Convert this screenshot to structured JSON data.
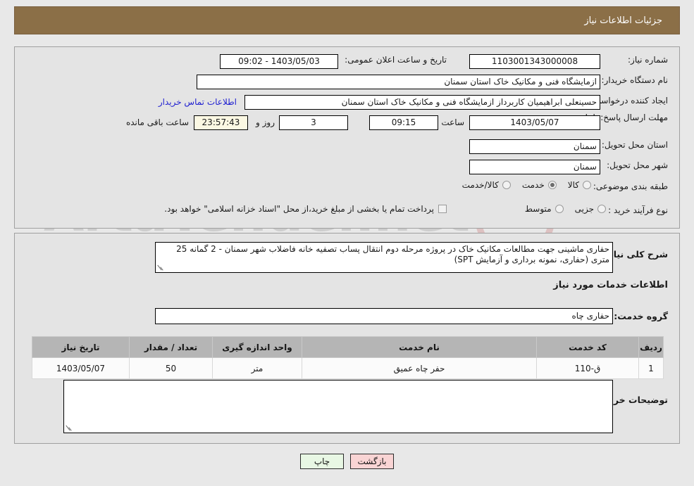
{
  "header": {
    "title": "جزئیات اطلاعات نیاز"
  },
  "watermark": {
    "text": "ArtaTender.net"
  },
  "top_panel": {
    "need_number": {
      "label": "شماره نیاز:",
      "value": "1103001343000008"
    },
    "announce_datetime": {
      "label": "تاریخ و ساعت اعلان عمومی:",
      "value": "1403/05/03 - 09:02"
    },
    "buyer_org": {
      "label": "نام دستگاه خریدار:",
      "value": "ازمایشگاه فنی و مکانیک خاک استان سمنان"
    },
    "requester": {
      "label": "ایجاد کننده درخواست:",
      "value": "حسینعلی ابراهیمیان کاربرداز ازمایشگاه فنی و مکانیک خاک استان سمنان",
      "contact_link": "اطلاعات تماس خریدار"
    },
    "deadline": {
      "label": "مهلت ارسال پاسخ: تا تاریخ:",
      "date": "1403/05/07",
      "time_label": "ساعت",
      "time": "09:15",
      "days": "3",
      "days_label": "روز و",
      "countdown": "23:57:43",
      "countdown_label": "ساعت باقی مانده"
    },
    "province": {
      "label": "استان محل تحویل:",
      "value": "سمنان"
    },
    "city": {
      "label": "شهر محل تحویل:",
      "value": "سمنان"
    },
    "category": {
      "label": "طبقه بندی موضوعی:",
      "options": [
        {
          "label": "کالا",
          "selected": false
        },
        {
          "label": "خدمت",
          "selected": true
        },
        {
          "label": "کالا/خدمت",
          "selected": false
        }
      ]
    },
    "purchase_type": {
      "label": "نوع فرآیند خرید :",
      "options": [
        {
          "label": "جزیی",
          "selected": false
        },
        {
          "label": "متوسط",
          "selected": false
        }
      ],
      "checkbox_label": "پرداخت تمام یا بخشی از مبلغ خرید،از محل \"اسناد خزانه اسلامی\" خواهد بود.",
      "checkbox_checked": false
    }
  },
  "mid_panel": {
    "general_desc": {
      "label": "شرح کلی نیاز:",
      "value": "حفاری ماشینی جهت مطالعات مکانیک خاک در پروژه مرحله دوم انتقال پساب تصفیه خانه فاضلاب شهر سمنان - 2 گمانه 25 متری (حفاری، نمونه برداری و آزمایش SPT)"
    },
    "services_section_title": "اطلاعات خدمات مورد نیاز",
    "service_group": {
      "label": "گروه خدمت:",
      "value": "حفاری چاه"
    },
    "table": {
      "columns": [
        "ردیف",
        "کد خدمت",
        "نام خدمت",
        "واحد اندازه گیری",
        "تعداد / مقدار",
        "تاریخ نیاز"
      ],
      "rows": [
        {
          "row": "1",
          "code": "ق-110",
          "name": "حفر چاه عمیق",
          "unit": "متر",
          "quantity": "50",
          "need_date": "1403/05/07"
        }
      ]
    },
    "buyer_notes": {
      "label": "توضیحات خریدار:",
      "value": ""
    }
  },
  "buttons": {
    "return": "بازگشت",
    "print": "چاپ"
  }
}
